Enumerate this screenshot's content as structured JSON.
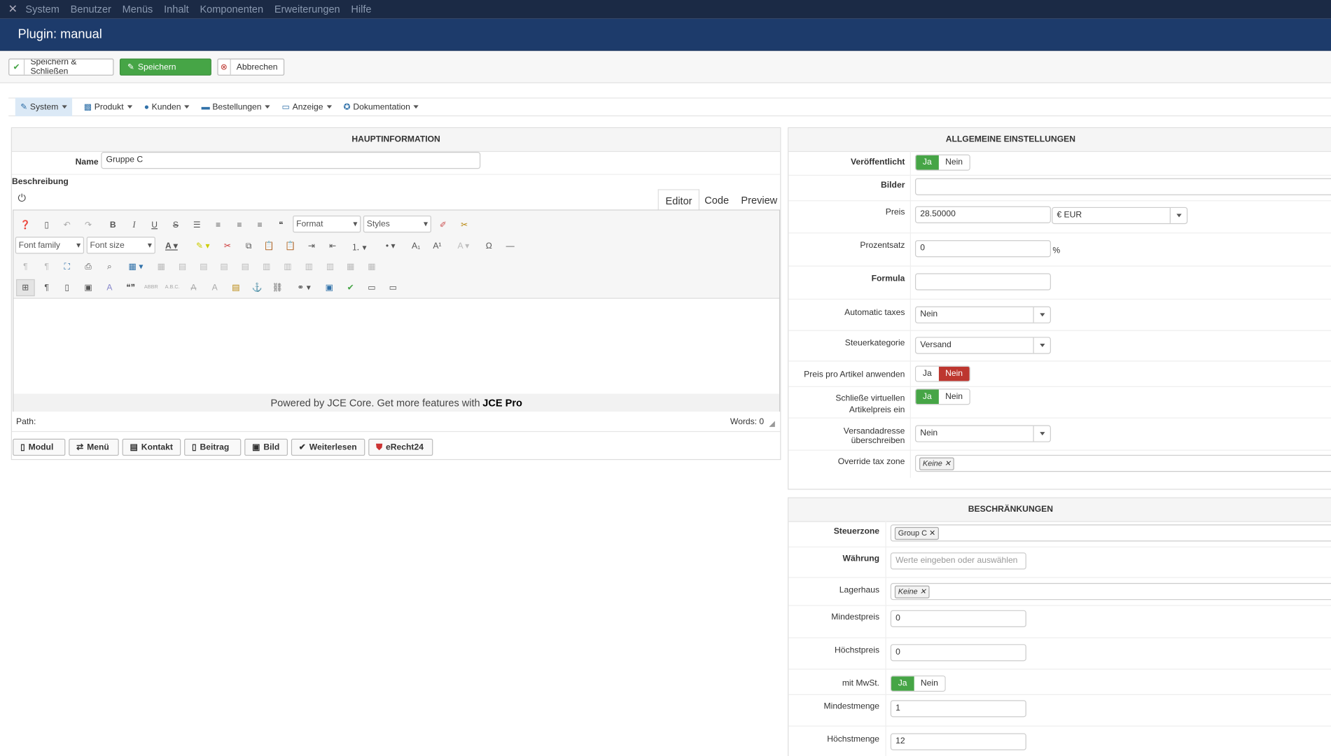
{
  "topnav": {
    "logo_icon": "joomla-logo-icon",
    "items": [
      "System",
      "Benutzer",
      "Menüs",
      "Inhalt",
      "Komponenten",
      "Erweiterungen",
      "Hilfe"
    ]
  },
  "title": "Plugin: manual",
  "toolbar": {
    "save_close": "Speichern & Schließen",
    "save": "Speichern",
    "cancel": "Abbrechen"
  },
  "tabs": [
    {
      "label": "System",
      "icon": "wrench-icon"
    },
    {
      "label": "Produkt",
      "icon": "cubes-icon"
    },
    {
      "label": "Kunden",
      "icon": "user-icon"
    },
    {
      "label": "Bestellungen",
      "icon": "credit-card-icon"
    },
    {
      "label": "Anzeige",
      "icon": "monitor-icon"
    },
    {
      "label": "Dokumentation",
      "icon": "help-icon"
    }
  ],
  "main": {
    "heading": "HAUPTINFORMATION",
    "name_label": "Name",
    "name_value": "Gruppe C",
    "desc_label": "Beschreibung",
    "editor_tabs": [
      "Editor",
      "Code",
      "Preview"
    ],
    "format_select": "Format",
    "styles_select": "Styles",
    "font_family_select": "Font family",
    "font_size_select": "Font size",
    "powered_prefix": "Powered by JCE Core. Get more features with ",
    "powered_brand": "JCE Pro",
    "path_label": "Path:",
    "words_label": "Words: 0",
    "buttons": [
      "Modul",
      "Menü",
      "Kontakt",
      "Beitrag",
      "Bild",
      "Weiterlesen",
      "eRecht24"
    ]
  },
  "general": {
    "heading": "ALLGEMEINE EINSTELLUNGEN",
    "published_label": "Veröffentlicht",
    "images_label": "Bilder",
    "price_label": "Preis",
    "price_value": "28.50000",
    "currency_value": "€ EUR",
    "percent_label": "Prozentsatz",
    "percent_value": "0",
    "percent_sign": "%",
    "formula_label": "Formula",
    "auto_taxes_label": "Automatic taxes",
    "auto_taxes_value": "Nein",
    "tax_cat_label": "Steuerkategorie",
    "tax_cat_value": "Versand",
    "price_per_item_label": "Preis pro Artikel anwenden",
    "virtual_label_1": "Schließe virtuellen",
    "virtual_label_2": "Artikelpreis ein",
    "ship_addr_label": "Versandadresse überschreiben",
    "ship_addr_value": "Nein",
    "override_label": "Override tax zone",
    "override_chip": "Keine",
    "yes": "Ja",
    "no": "Nein"
  },
  "restrictions": {
    "heading": "BESCHRÄNKUNGEN",
    "zone_label": "Steuerzone",
    "zone_chip": "Group C",
    "currency_label": "Währung",
    "currency_placeholder": "Werte eingeben oder auswählen",
    "warehouse_label": "Lagerhaus",
    "warehouse_chip": "Keine",
    "min_price_label": "Mindestpreis",
    "min_price_value": "0",
    "max_price_label": "Höchstpreis",
    "max_price_value": "0",
    "vat_label": "mit MwSt.",
    "min_qty_label": "Mindestmenge",
    "min_qty_value": "1",
    "max_qty_label": "Höchstmenge",
    "max_qty_value": "12"
  },
  "colors": {
    "topnav": "#1b2a45",
    "titlebar": "#1d3b6b",
    "success": "#46a546",
    "danger": "#bd362f"
  }
}
